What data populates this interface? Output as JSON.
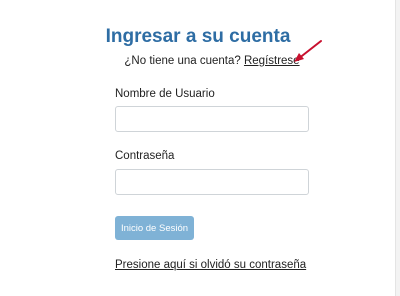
{
  "login": {
    "title": "Ingresar a su cuenta",
    "no_account_text": "¿No tiene una cuenta?",
    "register_link": "Regístrese",
    "username_label": "Nombre de Usuario",
    "username_value": "",
    "password_label": "Contraseña",
    "password_value": "",
    "login_button": "Inicio de Sesión",
    "forgot_link": "Presione aquí si olvidó su contraseña"
  },
  "colors": {
    "title": "#2e6da4",
    "button": "#7fb2d6",
    "annotation_arrow": "#c8102e"
  },
  "icons": {
    "annotation": "red-arrow-icon"
  }
}
